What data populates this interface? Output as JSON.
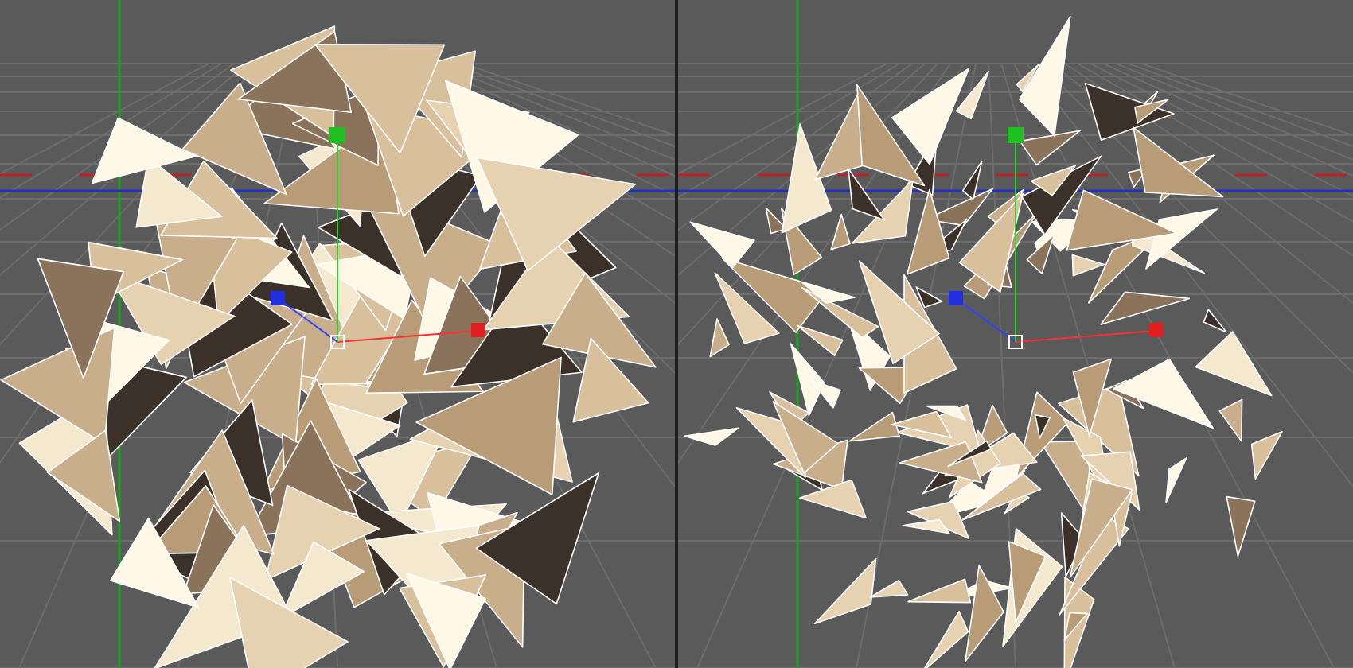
{
  "viewports": [
    {
      "kind": "intact"
    },
    {
      "kind": "shattered"
    }
  ]
}
